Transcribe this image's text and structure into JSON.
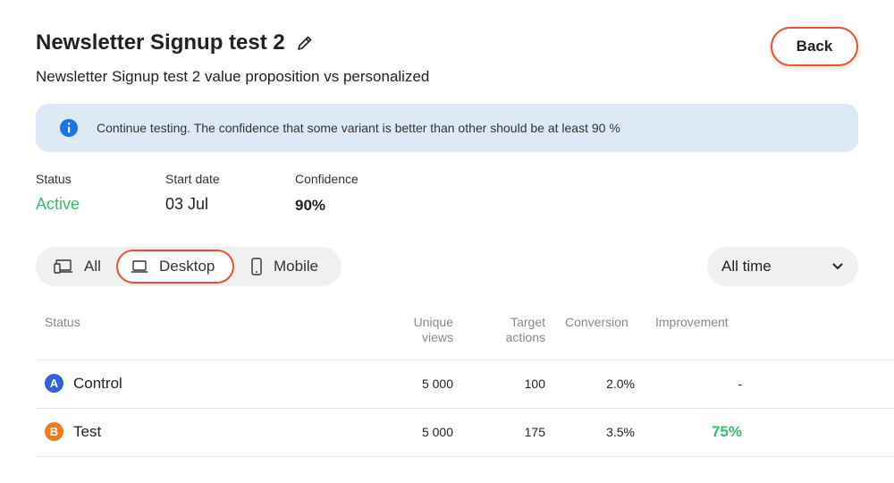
{
  "header": {
    "title": "Newsletter Signup test 2",
    "subtitle": "Newsletter Signup test 2 value proposition vs personalized",
    "back_label": "Back",
    "edit_icon": "pencil-icon"
  },
  "alert": {
    "icon": "info-icon",
    "text": "Continue testing. The confidence that some variant is better than other should be at least 90 %"
  },
  "stats": {
    "status_label": "Status",
    "status_value": "Active",
    "start_label": "Start date",
    "start_value": "03 Jul",
    "confidence_label": "Confidence",
    "confidence_value": "90%"
  },
  "device_filter": {
    "items": [
      {
        "label": "All",
        "icon": "devices-icon"
      },
      {
        "label": "Desktop",
        "icon": "laptop-icon"
      },
      {
        "label": "Mobile",
        "icon": "phone-icon"
      }
    ],
    "selected": "Desktop"
  },
  "time_filter": {
    "value": "All time",
    "icon": "chevron-down-icon"
  },
  "table": {
    "headers": {
      "status": "Status",
      "unique_views_1": "Unique",
      "unique_views_2": "views",
      "target_actions_1": "Target",
      "target_actions_2": "actions",
      "conversion": "Conversion",
      "improvement": "Improvement"
    },
    "rows": [
      {
        "badge": "A",
        "name": "Control",
        "views": "5 000",
        "actions": "100",
        "conversion": "2.0%",
        "improvement": "-"
      },
      {
        "badge": "B",
        "name": "Test",
        "views": "5 000",
        "actions": "175",
        "conversion": "3.5%",
        "improvement": "75%"
      }
    ]
  },
  "colors": {
    "accent": "#e8503a",
    "success": "#3cb96e",
    "info": "#1a73e8",
    "badge_a": "#3461d1",
    "badge_b": "#f07a22",
    "alert_bg": "#dde9f7"
  }
}
